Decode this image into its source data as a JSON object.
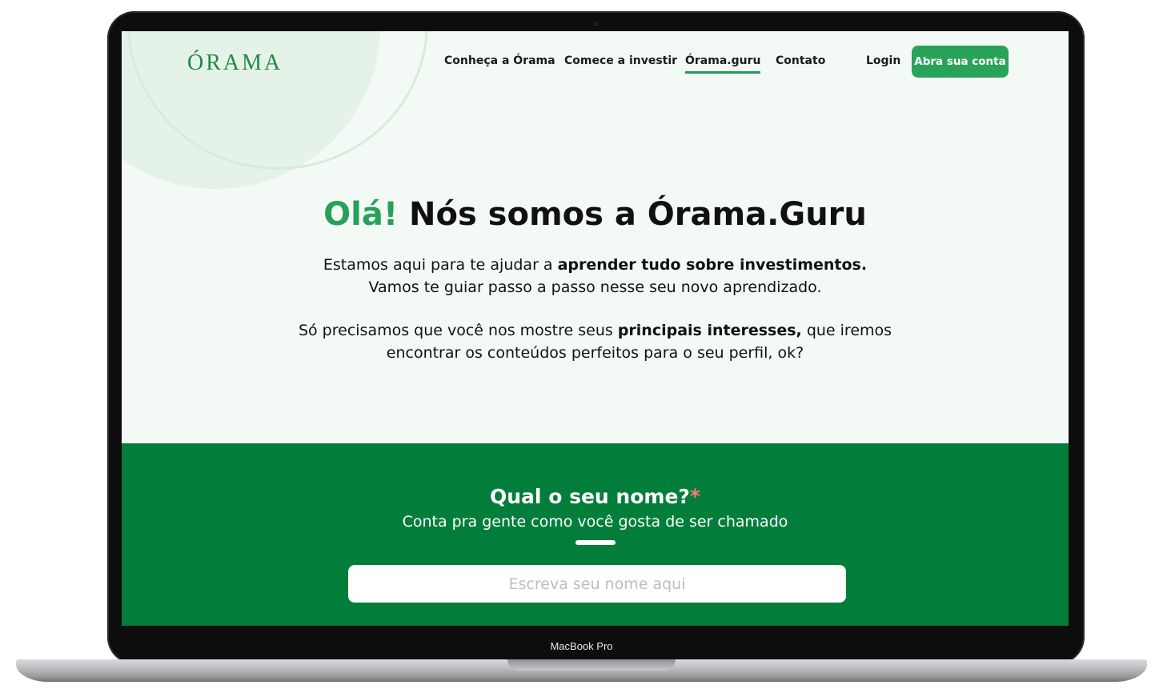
{
  "device": {
    "label": "MacBook Pro"
  },
  "header": {
    "logo": "ÓRAMA",
    "nav": [
      {
        "label": "Conheça a Órama",
        "active": false
      },
      {
        "label": "Comece a investir",
        "active": false
      },
      {
        "label": "Órama.guru",
        "active": true
      },
      {
        "label": "Contato",
        "active": false
      }
    ],
    "login_label": "Login",
    "cta_label": "Abra sua conta"
  },
  "hero": {
    "title_accent": "Olá!",
    "title_rest": " Nós somos a Órama.Guru",
    "p1_pre": "Estamos aqui para te ajudar a ",
    "p1_bold": "aprender tudo sobre investimentos.",
    "p1_line2": "Vamos te guiar passo a passo nesse seu novo aprendizado.",
    "p2_pre": "Só precisamos que você nos mostre seus ",
    "p2_bold": "principais interesses,",
    "p2_post": " que iremos",
    "p2_line2": "encontrar os conteúdos perfeitos para o seu perfil, ok?"
  },
  "form": {
    "question": "Qual o seu nome?",
    "required_mark": "*",
    "subtitle": "Conta pra gente como você gosta de ser chamado",
    "name_value": "",
    "name_placeholder": "Escreva seu nome aqui"
  },
  "colors": {
    "brand_green": "#27a05a",
    "section_green": "#037e3a",
    "required_red": "#ff7b73"
  }
}
